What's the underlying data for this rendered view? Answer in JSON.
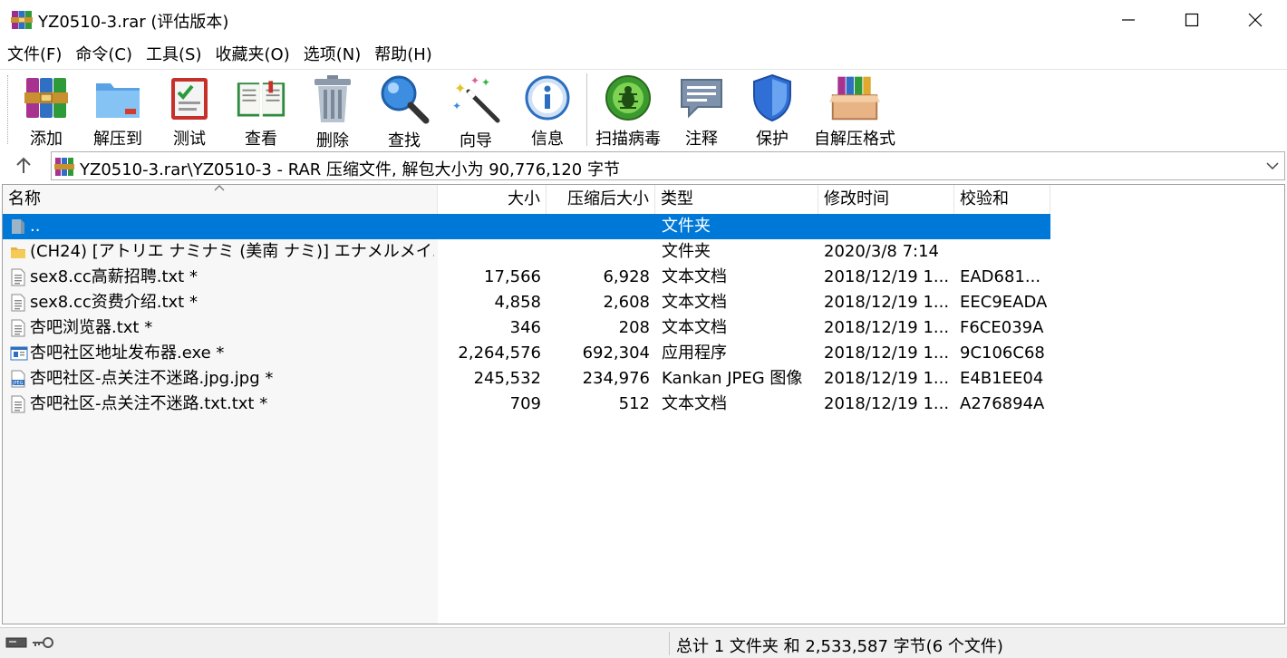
{
  "window": {
    "title": "YZ0510-3.rar (评估版本)",
    "controls": [
      "minimize",
      "maximize",
      "close"
    ]
  },
  "menu": [
    {
      "label": "文件(F)"
    },
    {
      "label": "命令(C)"
    },
    {
      "label": "工具(S)"
    },
    {
      "label": "收藏夹(O)"
    },
    {
      "label": "选项(N)"
    },
    {
      "label": "帮助(H)"
    }
  ],
  "toolbar": [
    {
      "label": "添加",
      "icon": "add-archive-icon"
    },
    {
      "label": "解压到",
      "icon": "extract-to-icon"
    },
    {
      "label": "测试",
      "icon": "test-icon"
    },
    {
      "label": "查看",
      "icon": "view-book-icon"
    },
    {
      "label": "删除",
      "icon": "trash-icon"
    },
    {
      "label": "查找",
      "icon": "magnifier-icon"
    },
    {
      "label": "向导",
      "icon": "wizard-wand-icon"
    },
    {
      "label": "信息",
      "icon": "info-icon"
    },
    {
      "label": "扫描病毒",
      "icon": "virus-scan-icon"
    },
    {
      "label": "注释",
      "icon": "comment-icon"
    },
    {
      "label": "保护",
      "icon": "shield-icon"
    },
    {
      "label": "自解压格式",
      "icon": "sfx-box-icon"
    }
  ],
  "address": {
    "text": "YZ0510-3.rar\\YZ0510-3 - RAR 压缩文件, 解包大小为 90,776,120 字节"
  },
  "columns": {
    "name": "名称",
    "size": "大小",
    "packed": "压缩后大小",
    "type": "类型",
    "modified": "修改时间",
    "crc": "校验和"
  },
  "files": [
    {
      "name": "..",
      "size": "",
      "packed": "",
      "type": "文件夹",
      "modified": "",
      "crc": "",
      "icon": "parent-folder-icon",
      "selected": true
    },
    {
      "name": "(CH24) [アトリエ ナミナミ (美南 ナミ)] エナメルメイ...",
      "size": "",
      "packed": "",
      "type": "文件夹",
      "modified": "2020/3/8 7:14",
      "crc": "",
      "icon": "folder-icon",
      "selected": false
    },
    {
      "name": "sex8.cc高薪招聘.txt *",
      "size": "17,566",
      "packed": "6,928",
      "type": "文本文档",
      "modified": "2018/12/19 1...",
      "crc": "EAD681...",
      "icon": "text-file-icon",
      "selected": false
    },
    {
      "name": "sex8.cc资费介绍.txt *",
      "size": "4,858",
      "packed": "2,608",
      "type": "文本文档",
      "modified": "2018/12/19 1...",
      "crc": "EEC9EADA",
      "icon": "text-file-icon",
      "selected": false
    },
    {
      "name": "杏吧浏览器.txt *",
      "size": "346",
      "packed": "208",
      "type": "文本文档",
      "modified": "2018/12/19 1...",
      "crc": "F6CE039A",
      "icon": "text-file-icon",
      "selected": false
    },
    {
      "name": "杏吧社区地址发布器.exe *",
      "size": "2,264,576",
      "packed": "692,304",
      "type": "应用程序",
      "modified": "2018/12/19 1...",
      "crc": "9C106C68",
      "icon": "exe-file-icon",
      "selected": false
    },
    {
      "name": "杏吧社区-点关注不迷路.jpg.jpg *",
      "size": "245,532",
      "packed": "234,976",
      "type": "Kankan JPEG 图像",
      "modified": "2018/12/19 1...",
      "crc": "E4B1EE04",
      "icon": "jpeg-file-icon",
      "selected": false
    },
    {
      "name": "杏吧社区-点关注不迷路.txt.txt *",
      "size": "709",
      "packed": "512",
      "type": "文本文档",
      "modified": "2018/12/19 1...",
      "crc": "A276894A",
      "icon": "text-file-icon",
      "selected": false
    }
  ],
  "status": {
    "summary": "总计 1 文件夹 和 2,533,587 字节(6 个文件)"
  },
  "colors": {
    "selection": "#0078d7",
    "name_column_bg": "#f7f7f7",
    "statusbar_bg": "#f0f0f0"
  }
}
